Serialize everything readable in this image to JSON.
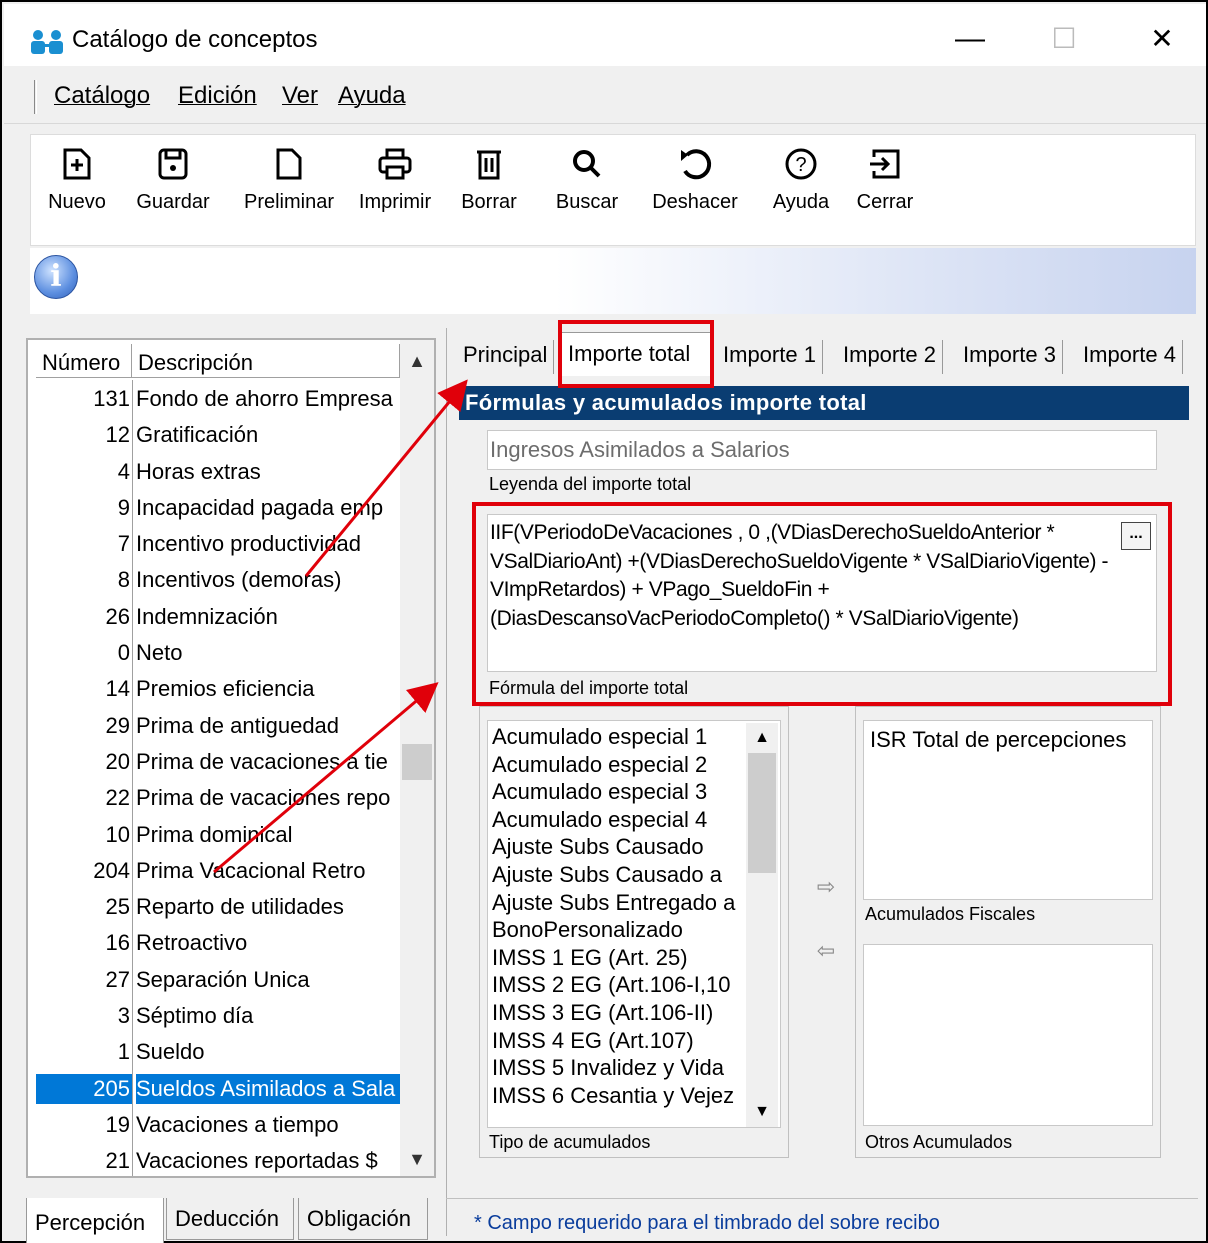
{
  "window": {
    "title": "Catálogo de conceptos",
    "minimize": "—",
    "maximize": "☐",
    "close": "✕"
  },
  "menu": {
    "items": [
      {
        "label": "Catálogo"
      },
      {
        "label": "Edición"
      },
      {
        "label": "Ver"
      },
      {
        "label": "Ayuda"
      }
    ]
  },
  "toolbar": {
    "tools": [
      {
        "label": "Nuevo",
        "icon": "new-doc-icon"
      },
      {
        "label": "Guardar",
        "icon": "save-icon"
      },
      {
        "label": "Preliminar",
        "icon": "preview-icon"
      },
      {
        "label": "Imprimir",
        "icon": "print-icon"
      },
      {
        "label": "Borrar",
        "icon": "delete-icon"
      },
      {
        "label": "Buscar",
        "icon": "search-icon"
      },
      {
        "label": "Deshacer",
        "icon": "undo-icon"
      },
      {
        "label": "Ayuda",
        "icon": "help-icon"
      },
      {
        "label": "Cerrar",
        "icon": "exit-icon"
      }
    ]
  },
  "info": {
    "icon_glyph": "i"
  },
  "list": {
    "col_number": "Número",
    "col_description": "Descripción",
    "scroll_up": "▲",
    "scroll_down": "▼",
    "rows": [
      {
        "num": "131",
        "desc": "Fondo de ahorro Empresa"
      },
      {
        "num": "12",
        "desc": "Gratificación"
      },
      {
        "num": "4",
        "desc": "Horas extras"
      },
      {
        "num": "9",
        "desc": "Incapacidad pagada emp"
      },
      {
        "num": "7",
        "desc": "Incentivo productividad"
      },
      {
        "num": "8",
        "desc": "Incentivos (demoras)"
      },
      {
        "num": "26",
        "desc": "Indemnización"
      },
      {
        "num": "0",
        "desc": "Neto"
      },
      {
        "num": "14",
        "desc": "Premios eficiencia"
      },
      {
        "num": "29",
        "desc": "Prima de antiguedad"
      },
      {
        "num": "20",
        "desc": "Prima de vacaciones a tie"
      },
      {
        "num": "22",
        "desc": "Prima de vacaciones repo"
      },
      {
        "num": "10",
        "desc": "Prima dominical"
      },
      {
        "num": "204",
        "desc": "Prima Vacacional Retro"
      },
      {
        "num": "25",
        "desc": "Reparto de utilidades"
      },
      {
        "num": "16",
        "desc": "Retroactivo"
      },
      {
        "num": "27",
        "desc": "Separación Unica"
      },
      {
        "num": "3",
        "desc": "Séptimo día"
      },
      {
        "num": "1",
        "desc": "Sueldo"
      },
      {
        "num": "205",
        "desc": "Sueldos Asimilados a Sala",
        "selected": true
      },
      {
        "num": "19",
        "desc": "Vacaciones a tiempo"
      },
      {
        "num": "21",
        "desc": "Vacaciones reportadas $"
      }
    ]
  },
  "left_tabs": {
    "percepcion": "Percepción",
    "deduccion": "Deducción",
    "obligacion": "Obligación"
  },
  "right_tabs": {
    "principal": "Principal",
    "importe_total": "Importe total",
    "importe1": "Importe 1",
    "importe2": "Importe 2",
    "importe3": "Importe 3",
    "importe4": "Importe 4"
  },
  "importe": {
    "section_title": "Fórmulas y acumulados importe total",
    "legend_value": "Ingresos Asimilados a Salarios",
    "legend_label": "Leyenda del importe total",
    "formula_value": "IIF(VPeriodoDeVacaciones , 0 ,(VDiasDerechoSueldoAnterior * VSalDiarioAnt) +(VDiasDerechoSueldoVigente * VSalDiarioVigente) - VImpRetardos) + VPago_SueldoFin +(DiasDescansoVacPeriodoCompleto() * VSalDiarioVigente)",
    "formula_label": "Fórmula del importe total",
    "dots_button": "...",
    "acumulados": [
      "Acumulado especial 1",
      "Acumulado especial 2",
      "Acumulado especial 3",
      "Acumulado especial 4",
      "Ajuste Subs Causado",
      "Ajuste Subs Causado a",
      "Ajuste Subs Entregado a",
      "BonoPersonalizado",
      "IMSS 1 EG (Art. 25)",
      "IMSS 2 EG (Art.106-I,10",
      "IMSS 3 EG (Art.106-II)",
      "IMSS 4 EG (Art.107)",
      "IMSS 5 Invalidez y Vida",
      "IMSS 6 Cesantia y Vejez"
    ],
    "tipo_label": "Tipo de acumulados",
    "add_arrow": "⇨",
    "remove_arrow": "⇦",
    "fiscales_value": "ISR Total de percepciones",
    "fiscales_label": "Acumulados Fiscales",
    "otros_label": "Otros Acumulados"
  },
  "footer_note": "* Campo requerido para el timbrado del sobre recibo",
  "colors": {
    "selection": "#0078d7",
    "section_bar": "#0a3d72",
    "annotation": "#e0000a"
  }
}
